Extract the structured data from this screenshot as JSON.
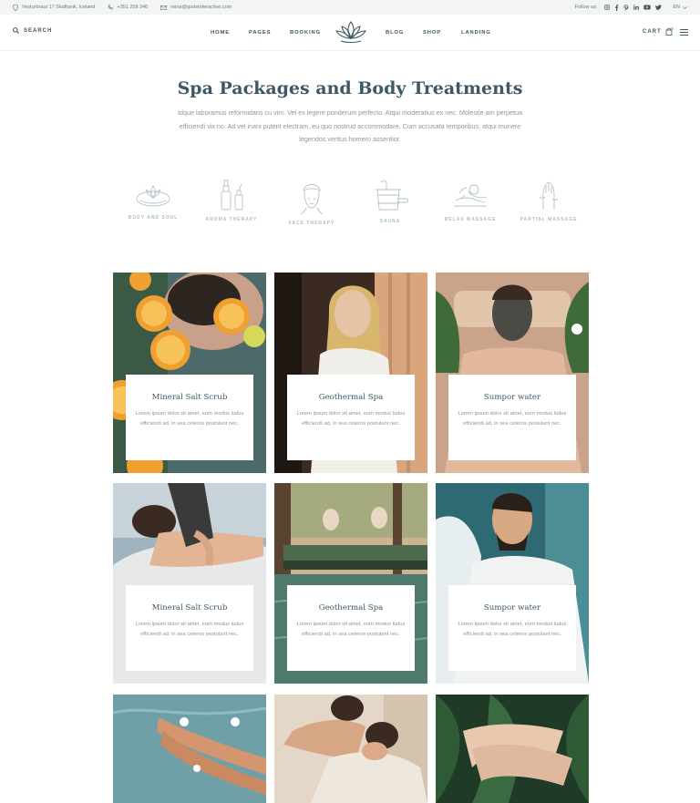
{
  "topbar": {
    "address": "Vesturbraut 17 Skaftavik, Iceland",
    "phone": "+351 258 346",
    "email": "reina@qodeinteractive.com",
    "follow_label": "Follow us:",
    "social_icons": [
      "instagram-icon",
      "facebook-icon",
      "pinterest-icon",
      "linkedin-icon",
      "youtube-icon",
      "twitter-icon"
    ],
    "language": "EN"
  },
  "header": {
    "search_label": "SEARCH",
    "nav": [
      "HOME",
      "PAGES",
      "BOOKING",
      "BLOG",
      "SHOP",
      "LANDING"
    ],
    "cart_label": "CART",
    "logo_icon": "lotus-logo-icon"
  },
  "hero": {
    "title": "Spa Packages and Body Treatments",
    "description": "Idque laboramus reformidans cu vim. Vel ex legere ponderum perfecto. Atqui moderatius ex nec. Molestie am perpetua efficiendi vix no. Ad vel inani putent electram, eu quo nostrud accommodare. Cum accusata temporibus, atqui munere legendos veritus homero assentior."
  },
  "categories": [
    {
      "label": "BODY AND SOUL",
      "icon": "lotus-bowl-icon"
    },
    {
      "label": "AROMA THERAPY",
      "icon": "aroma-bottle-icon"
    },
    {
      "label": "FACE THERAPY",
      "icon": "face-towel-icon"
    },
    {
      "label": "SAUNA",
      "icon": "sauna-bucket-icon"
    },
    {
      "label": "RELAX MASSAGE",
      "icon": "massage-icon"
    },
    {
      "label": "PARTIAL MASSAGE",
      "icon": "hand-massage-icon"
    }
  ],
  "cards": [
    {
      "title": "Mineral Salt Scrub",
      "text": "Lorem ipsum dolor sit amet, eum modus ludus efficiendi ad, in sea ceteros postulant nec."
    },
    {
      "title": "Geothermal Spa",
      "text": "Lorem ipsum dolor sit amet, eum modus ludus efficiendi ad, in sea ceteros postulant nec."
    },
    {
      "title": "Sumpor water",
      "text": "Lorem ipsum dolor sit amet, eum modus ludus efficiendi ad, in sea ceteros postulant nec."
    },
    {
      "title": "Mineral Salt Scrub",
      "text": "Lorem ipsum dolor sit amet, eum modus ludus efficiendi ad, in sea ceteros postulant nec."
    },
    {
      "title": "Geothermal Spa",
      "text": "Lorem ipsum dolor sit amet, eum modus ludus efficiendi ad, in sea ceteros postulant nec."
    },
    {
      "title": "Sumpor water",
      "text": "Lorem ipsum dolor sit amet, eum modus ludus efficiendi ad, in sea ceteros postulant nec."
    }
  ],
  "colors": {
    "heading": "#3f5866",
    "accent": "#a8c0c7",
    "muted_text": "#8a979d"
  }
}
